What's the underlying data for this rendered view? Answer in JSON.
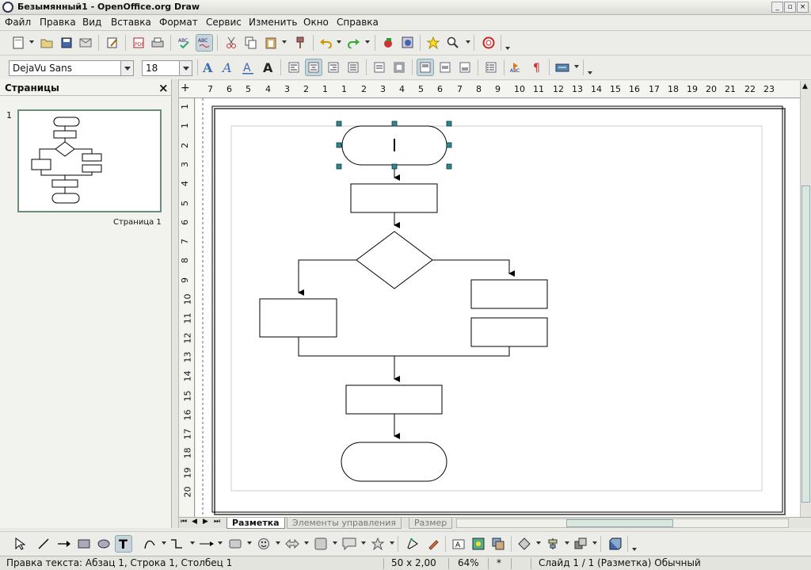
{
  "window": {
    "title": "Безымянный1 - OpenOffice.org Draw"
  },
  "menu": [
    "Файл",
    "Правка",
    "Вид",
    "Вставка",
    "Формат",
    "Сервис",
    "Изменить",
    "Окно",
    "Справка"
  ],
  "format_bar": {
    "font_name": "DejaVu Sans",
    "font_size": "18"
  },
  "pages_panel": {
    "title": "Страницы",
    "close": "×",
    "page_number": "1",
    "page_label": "Страница 1"
  },
  "rulers": {
    "horizontal": [
      "7",
      "6",
      "5",
      "4",
      "3",
      "2",
      "1",
      "1",
      "2",
      "3",
      "4",
      "5",
      "6",
      "7",
      "8",
      "9",
      "10",
      "11",
      "12",
      "13",
      "14",
      "15",
      "16",
      "17",
      "18",
      "19",
      "20",
      "21",
      "22",
      "23"
    ],
    "vertical": [
      "1",
      "1",
      "2",
      "3",
      "4",
      "5",
      "6",
      "7",
      "8",
      "9",
      "10",
      "11",
      "12",
      "13",
      "14",
      "15",
      "16",
      "17",
      "18",
      "19",
      "20"
    ]
  },
  "tabs": [
    "Разметка",
    "Элементы управления",
    "Размер"
  ],
  "status": {
    "edit_info": "Правка текста: Абзац 1, Строка 1, Столбец 1",
    "size": "50 x 2,00",
    "zoom": "64%",
    "modified": "*",
    "slide_info": "Слайд 1 / 1 (Разметка) Обычный"
  },
  "icons": {
    "top_toolbar": [
      "new-icon",
      "open-icon",
      "save-icon",
      "mail-icon",
      "edit-icon",
      "pdf-icon",
      "print-icon",
      "spellcheck-icon",
      "autospell-icon",
      "cut-icon",
      "copy-icon",
      "paste-icon",
      "clone-format-icon",
      "undo-icon",
      "redo-icon",
      "gallery-icon",
      "navigator-icon",
      "star-icon",
      "zoom-icon",
      "help-icon"
    ],
    "draw_toolbar": [
      "select-icon",
      "line-icon",
      "arrow-line-icon",
      "rectangle-icon",
      "ellipse-icon",
      "text-icon",
      "curve-icon",
      "connector-icon",
      "lines-arrows-icon",
      "basic-shapes-icon",
      "symbol-shapes-icon",
      "block-arrows-icon",
      "flowchart-icon",
      "callouts-icon",
      "stars-icon",
      "points-icon",
      "glue-points-icon",
      "fontwork-icon",
      "from-file-icon",
      "gallery-icon",
      "rotate-icon",
      "align-icon",
      "arrange-icon",
      "extrusion-icon"
    ]
  },
  "colors": {
    "accent": "#6c8c7c",
    "handle": "#2a8a8a"
  }
}
